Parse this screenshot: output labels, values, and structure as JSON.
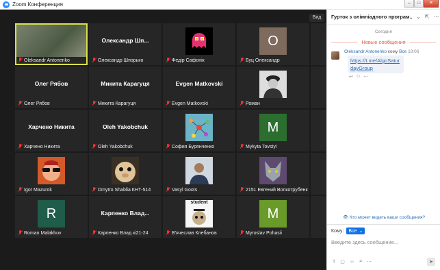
{
  "window": {
    "title": "Zoom Конференция",
    "minimize": "–",
    "maximize": "□",
    "close": "✕"
  },
  "video": {
    "view_label": "Вид",
    "tiles": [
      {
        "name": "Oleksandr Antonenko",
        "type": "camera",
        "active": true
      },
      {
        "name": "Олександр Шпорько",
        "type": "name",
        "display": "Олександр Шп..."
      },
      {
        "name": "Федір Сафонік",
        "type": "pacman"
      },
      {
        "name": "Буц Олександр",
        "type": "letter",
        "letter": "О",
        "color": "#7f6a5e"
      },
      {
        "name": "",
        "type": "empty"
      },
      {
        "name": "Олег Рябов",
        "type": "name",
        "display": "Олег Рябов"
      },
      {
        "name": "Микита Карагуця",
        "type": "name",
        "display": "Микита Карагуця"
      },
      {
        "name": "Evgen Matkovski",
        "type": "name",
        "display": "Evgen Matkovski"
      },
      {
        "name": "Роман",
        "type": "police"
      },
      {
        "name": "",
        "type": "empty"
      },
      {
        "name": "Харчено Никита",
        "type": "name",
        "display": "Харчено Никита"
      },
      {
        "name": "Oleh Yakobchuk",
        "type": "name",
        "display": "Oleh Yakobchuk"
      },
      {
        "name": "София Бурянченко",
        "type": "network"
      },
      {
        "name": "Mykyta Tovstyi",
        "type": "letter",
        "letter": "M",
        "color": "#2c6e30"
      },
      {
        "name": "",
        "type": "empty"
      },
      {
        "name": "Igor Mazurok",
        "type": "sunglasses"
      },
      {
        "name": "Dmytro Shablia КНТ-514",
        "type": "hamster"
      },
      {
        "name": "Vasyl Goots",
        "type": "person"
      },
      {
        "name": "2151 Евгений Волкотрубенко",
        "type": "wolf"
      },
      {
        "name": "",
        "type": "empty"
      },
      {
        "name": "Roman Malakhov",
        "type": "letter",
        "letter": "R",
        "color": "#1f5c4a"
      },
      {
        "name": "Карпенко Влад кі21-24",
        "type": "name",
        "display": "Карпенко Влад..."
      },
      {
        "name": "В'ячеслав Клебанов",
        "type": "student",
        "caption": "student"
      },
      {
        "name": "Myroslav Pohasii",
        "type": "letter",
        "letter": "M",
        "color": "#6a9a2a"
      },
      {
        "name": "",
        "type": "empty"
      }
    ]
  },
  "chat": {
    "title": "Гурток з олімпіадного програм...",
    "date": "Сегодня",
    "new_messages": "Новые сообщения",
    "message": {
      "sender": "Oleksandr Antonenko",
      "to_prefix": "кому",
      "to": "Все",
      "time": "18:06",
      "link": "https://t.me/AlgoSaturdayGroup"
    },
    "who_can_see": "Кто может видеть ваши сообщения?",
    "to_label": "Кому:",
    "to_value": "Все",
    "placeholder": "Введите здесь сообщение..."
  }
}
